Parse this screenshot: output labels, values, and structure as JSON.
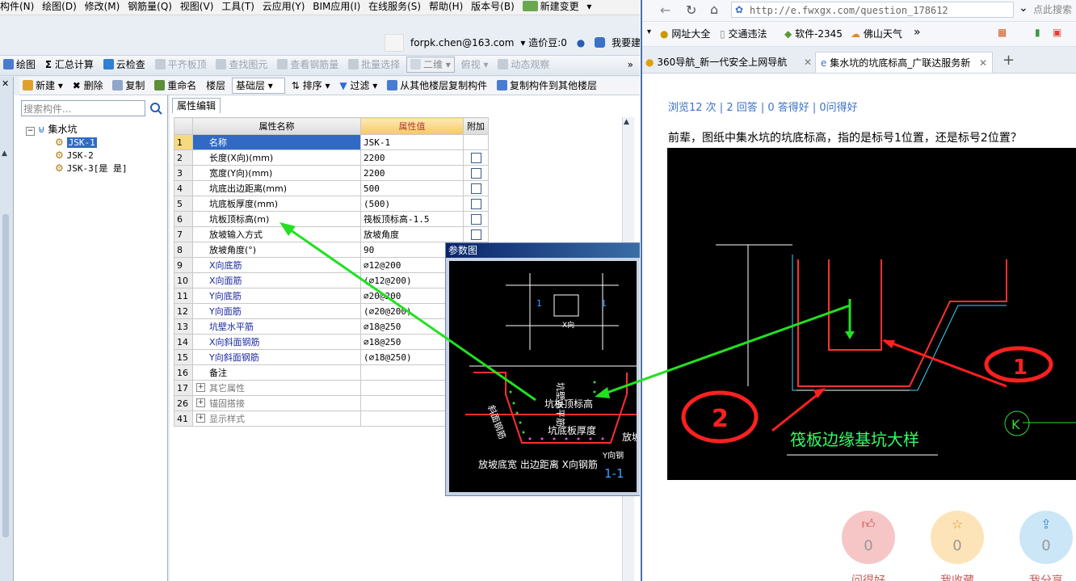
{
  "menubar": [
    "构件(N)",
    "绘图(D)",
    "修改(M)",
    "钢筋量(Q)",
    "视图(V)",
    "工具(T)",
    "云应用(Y)",
    "BIM应用(I)",
    "在线服务(S)",
    "帮助(H)",
    "版本号(B)",
    "新建变更"
  ],
  "userbar": {
    "email": "forpk.chen@163.com",
    "beans": "造价豆:0",
    "suggest": "我要建议"
  },
  "toolbar1": [
    "绘图",
    "汇总计算",
    "云检查",
    "平齐板顶",
    "查找图元",
    "查看钢筋量",
    "批量选择",
    "二维",
    "俯视",
    "动态观察"
  ],
  "toolbar1_disabled": [
    false,
    false,
    false,
    true,
    true,
    true,
    true,
    false,
    true,
    true
  ],
  "toolbar2": {
    "new": "新建",
    "delete": "删除",
    "copy": "复制",
    "rename": "重命名",
    "floor_label": "楼层",
    "floor_value": "基础层",
    "sort": "排序",
    "filter": "过滤",
    "copy_from": "从其他楼层复制构件",
    "copy_to": "复制构件到其他楼层"
  },
  "search": {
    "placeholder": "搜索构件..."
  },
  "tree": {
    "root": "集水坑",
    "items": [
      "JSK-1",
      "JSK-2",
      "JSK-3[是 是]"
    ]
  },
  "tab": "属性编辑",
  "grid": {
    "headers": [
      "属性名称",
      "属性值",
      "附加"
    ],
    "rows": [
      {
        "n": "1",
        "name": "名称",
        "value": "JSK-1",
        "check": false,
        "style": "sel"
      },
      {
        "n": "2",
        "name": "长度(X向)(mm)",
        "value": "2200",
        "check": true,
        "style": ""
      },
      {
        "n": "3",
        "name": "宽度(Y向)(mm)",
        "value": "2200",
        "check": true,
        "style": ""
      },
      {
        "n": "4",
        "name": "坑底出边距离(mm)",
        "value": "500",
        "check": true,
        "style": ""
      },
      {
        "n": "5",
        "name": "坑底板厚度(mm)",
        "value": "(500)",
        "check": true,
        "style": ""
      },
      {
        "n": "6",
        "name": "坑板顶标高(m)",
        "value": "筏板顶标高-1.5",
        "check": true,
        "style": ""
      },
      {
        "n": "7",
        "name": "放坡输入方式",
        "value": "放坡角度",
        "check": true,
        "style": ""
      },
      {
        "n": "8",
        "name": "放坡角度(°)",
        "value": "90",
        "check": true,
        "style": ""
      },
      {
        "n": "9",
        "name": "X向底筋",
        "value": "⌀12@200",
        "check": true,
        "style": "blue"
      },
      {
        "n": "10",
        "name": "X向面筋",
        "value": "(⌀12@200)",
        "check": true,
        "style": "blue"
      },
      {
        "n": "11",
        "name": "Y向底筋",
        "value": "⌀20@200",
        "check": true,
        "style": "blue"
      },
      {
        "n": "12",
        "name": "Y向面筋",
        "value": "(⌀20@200)",
        "check": true,
        "style": "blue"
      },
      {
        "n": "13",
        "name": "坑壁水平筋",
        "value": "⌀18@250",
        "check": true,
        "style": "blue"
      },
      {
        "n": "14",
        "name": "X向斜面钢筋",
        "value": "⌀18@250",
        "check": true,
        "style": "blue"
      },
      {
        "n": "15",
        "name": "Y向斜面钢筋",
        "value": "(⌀18@250)",
        "check": true,
        "style": "blue"
      },
      {
        "n": "16",
        "name": "备注",
        "value": "",
        "check": false,
        "style": ""
      },
      {
        "n": "17",
        "name": "其它属性",
        "value": "",
        "check": false,
        "style": "gray"
      },
      {
        "n": "26",
        "name": "锚固搭接",
        "value": "",
        "check": false,
        "style": "gray"
      },
      {
        "n": "41",
        "name": "显示样式",
        "value": "",
        "check": false,
        "style": "gray"
      }
    ]
  },
  "popup": {
    "title": "参数图",
    "labels": {
      "xdir": "X向",
      "ydir": "Y向",
      "sec1": "1",
      "wall": "坑壁水平筋",
      "top": "坑板顶标高",
      "slope": "斜面钢筋",
      "thick": "坑底板厚度",
      "fangpo": "放坡",
      "bottom": "放坡底宽 出边距离 X向钢筋",
      "yrebar": "Y向钢",
      "sec11": "1-1"
    }
  },
  "browser": {
    "url": "http://e.fwxgx.com/question_178612",
    "search_placeholder": "点此搜索",
    "favorites": [
      "网址大全",
      "交通违法",
      "软件-2345",
      "佛山天气"
    ],
    "tabs": [
      "360导航_新一代安全上网导航",
      "集水坑的坑底标高_广联达服务新"
    ],
    "stats": "浏览12 次 | 2 回答 | 0 答得好 | 0问得好",
    "question": "前辈，图纸中集水坑的坑底标高，指的是标号1位置，还是标号2位置？",
    "cad_title": "筏板边缘基坑大样",
    "cad_marker": "K",
    "circle1": "1",
    "circle2": "2",
    "actions": [
      {
        "count": "0",
        "label": "问得好",
        "color": "#f6c6c6",
        "icon": "thumb-icon"
      },
      {
        "count": "0",
        "label": "我收藏",
        "color": "#fde4b8",
        "icon": "star-icon"
      },
      {
        "count": "0",
        "label": "我分享",
        "color": "#cbe6f6",
        "icon": "share-icon"
      }
    ]
  },
  "colors": {
    "arrow": "#22e022",
    "select": "#316ac5",
    "link": "#3a72c8"
  }
}
